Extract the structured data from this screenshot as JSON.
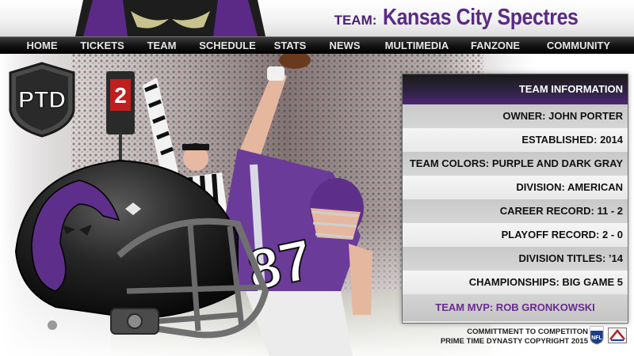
{
  "header": {
    "team_label": "TEAM:",
    "team_name": "Kansas City Spectres"
  },
  "nav": [
    "HOME",
    "TICKETS",
    "TEAM",
    "SCHEDULE",
    "STATS",
    "NEWS",
    "MULTIMEDIA",
    "FANZONE",
    "COMMUNITY"
  ],
  "logo": {
    "text": "PTD"
  },
  "jersey_number": "87",
  "sign_number": "2",
  "info": {
    "title": "TEAM INFORMATION",
    "rows": [
      "OWNER:  JOHN PORTER",
      "ESTABLISHED: 2014",
      "TEAM COLORS: PURPLE AND DARK GRAY",
      "DIVISION: AMERICAN",
      "CAREER RECORD: 11 - 2",
      "PLAYOFF RECORD: 2 - 0",
      "DIVISION TITLES: ’14",
      "CHAMPIONSHIPS:  BIG GAME 5"
    ],
    "mvp": "TEAM MVP: ROB GRONKOWSKI"
  },
  "footer": {
    "line1": "COMMITTMENT TO COMPETITON",
    "line2": "PRIME TIME DYNASTY COPYRIGHT 2015",
    "nfl_text": "NFL"
  },
  "colors": {
    "purple": "#5a2a86",
    "dark": "#1b1b1b",
    "accent": "#6a2a92"
  }
}
